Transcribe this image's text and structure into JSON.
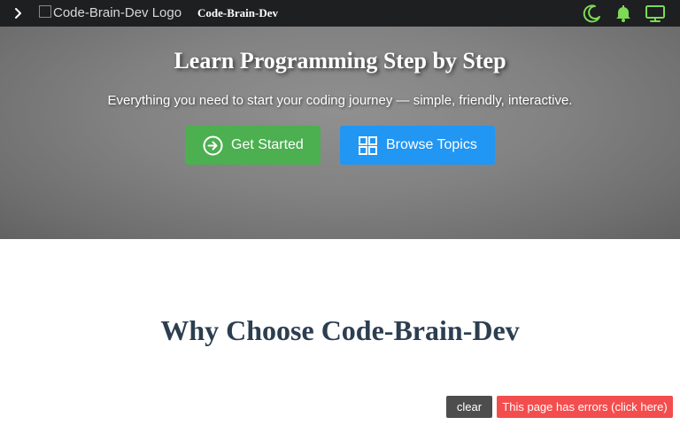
{
  "topbar": {
    "menu_icon": "chevron-right-icon",
    "logo_alt": "Code-Brain-Dev Logo",
    "brand": "Code-Brain-Dev",
    "icons": [
      "moon-icon",
      "bell-icon",
      "monitor-icon"
    ],
    "icon_color": "#7ed957"
  },
  "hero": {
    "title": "Learn Programming Step by Step",
    "subtitle": "Everything you need to start your coding journey — simple, friendly, interactive.",
    "primary_button": {
      "label": "Get Started",
      "icon": "arrow-circle-right-icon",
      "color": "#4caf50"
    },
    "secondary_button": {
      "label": "Browse Topics",
      "icon": "grid-icon",
      "color": "#2196f3"
    }
  },
  "section": {
    "heading": "Why Choose Code-Brain-Dev"
  },
  "debug": {
    "clear_label": " clear",
    "errors_label": "This page has errors (click here)"
  }
}
